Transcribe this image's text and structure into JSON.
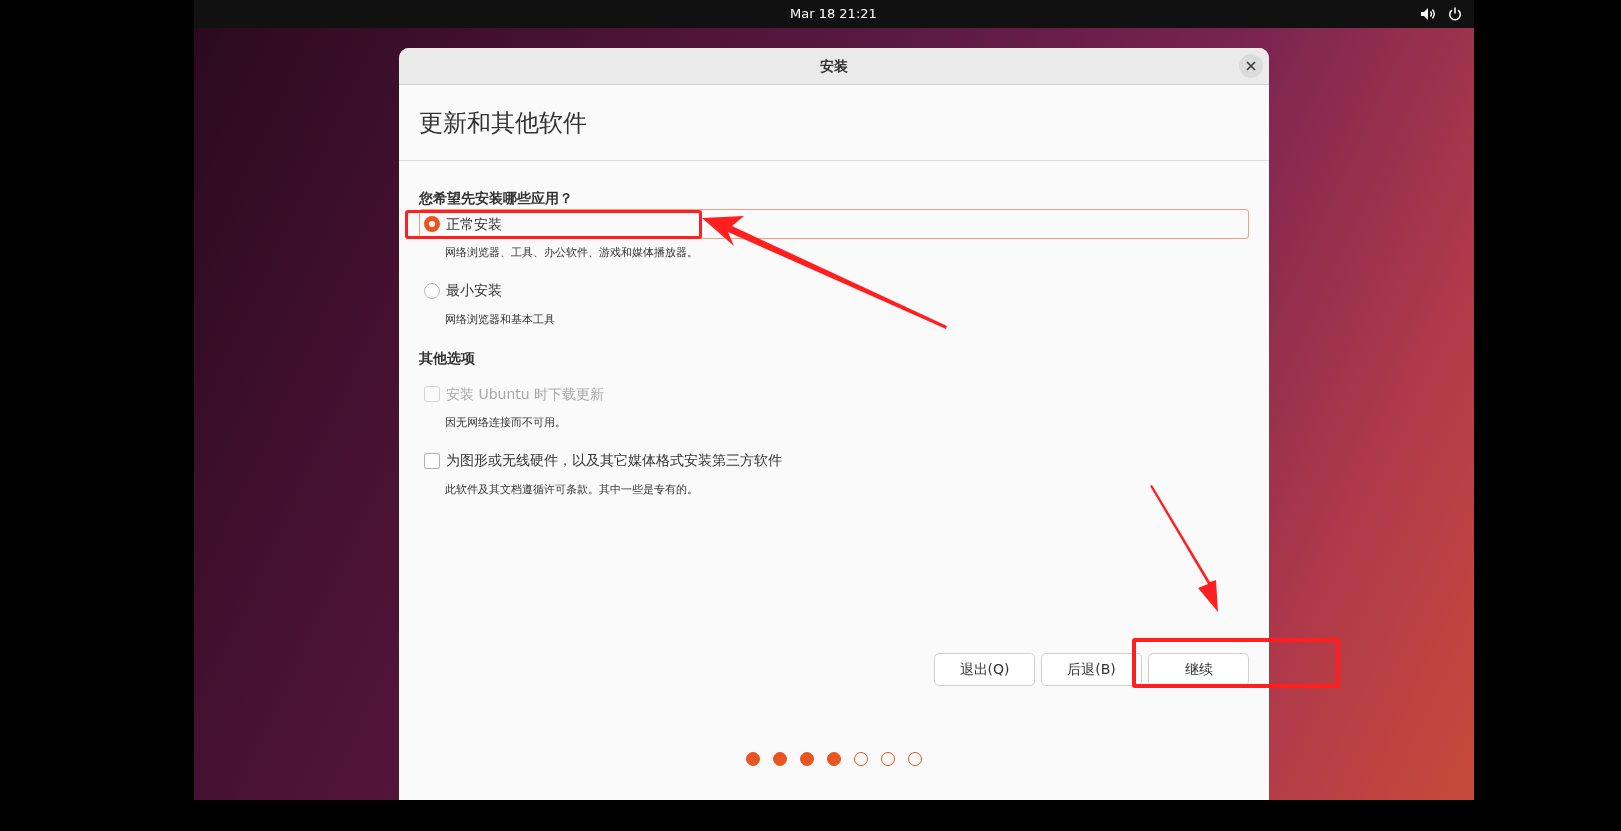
{
  "top_bar": {
    "clock": "Mar 18  21:21"
  },
  "window": {
    "title": "安装",
    "heading": "更新和其他软件",
    "sections": [
      {
        "title": "您希望先安装哪些应用？",
        "options": [
          {
            "kind": "radio",
            "label": "正常安装",
            "description": "网络浏览器、工具、办公软件、游戏和媒体播放器。",
            "selected": true,
            "focused": true
          },
          {
            "kind": "radio",
            "label": "最小安装",
            "description": "网络浏览器和基本工具",
            "selected": false,
            "focused": false
          }
        ]
      },
      {
        "title": "其他选项",
        "options": [
          {
            "kind": "checkbox",
            "label": "安装 Ubuntu 时下载更新",
            "description": "因无网络连接而不可用。",
            "checked": false,
            "disabled": true
          },
          {
            "kind": "checkbox",
            "label": "为图形或无线硬件，以及其它媒体格式安装第三方软件",
            "description": "此软件及其文档遵循许可条款。其中一些是专有的。",
            "checked": false,
            "disabled": false
          }
        ]
      }
    ],
    "buttons": [
      "退出(Q)",
      "后退(B)",
      "继续"
    ],
    "steps": [
      {
        "done": true
      },
      {
        "done": true
      },
      {
        "done": true
      },
      {
        "done": true
      },
      {
        "done": false
      },
      {
        "done": false
      },
      {
        "done": false
      }
    ]
  }
}
